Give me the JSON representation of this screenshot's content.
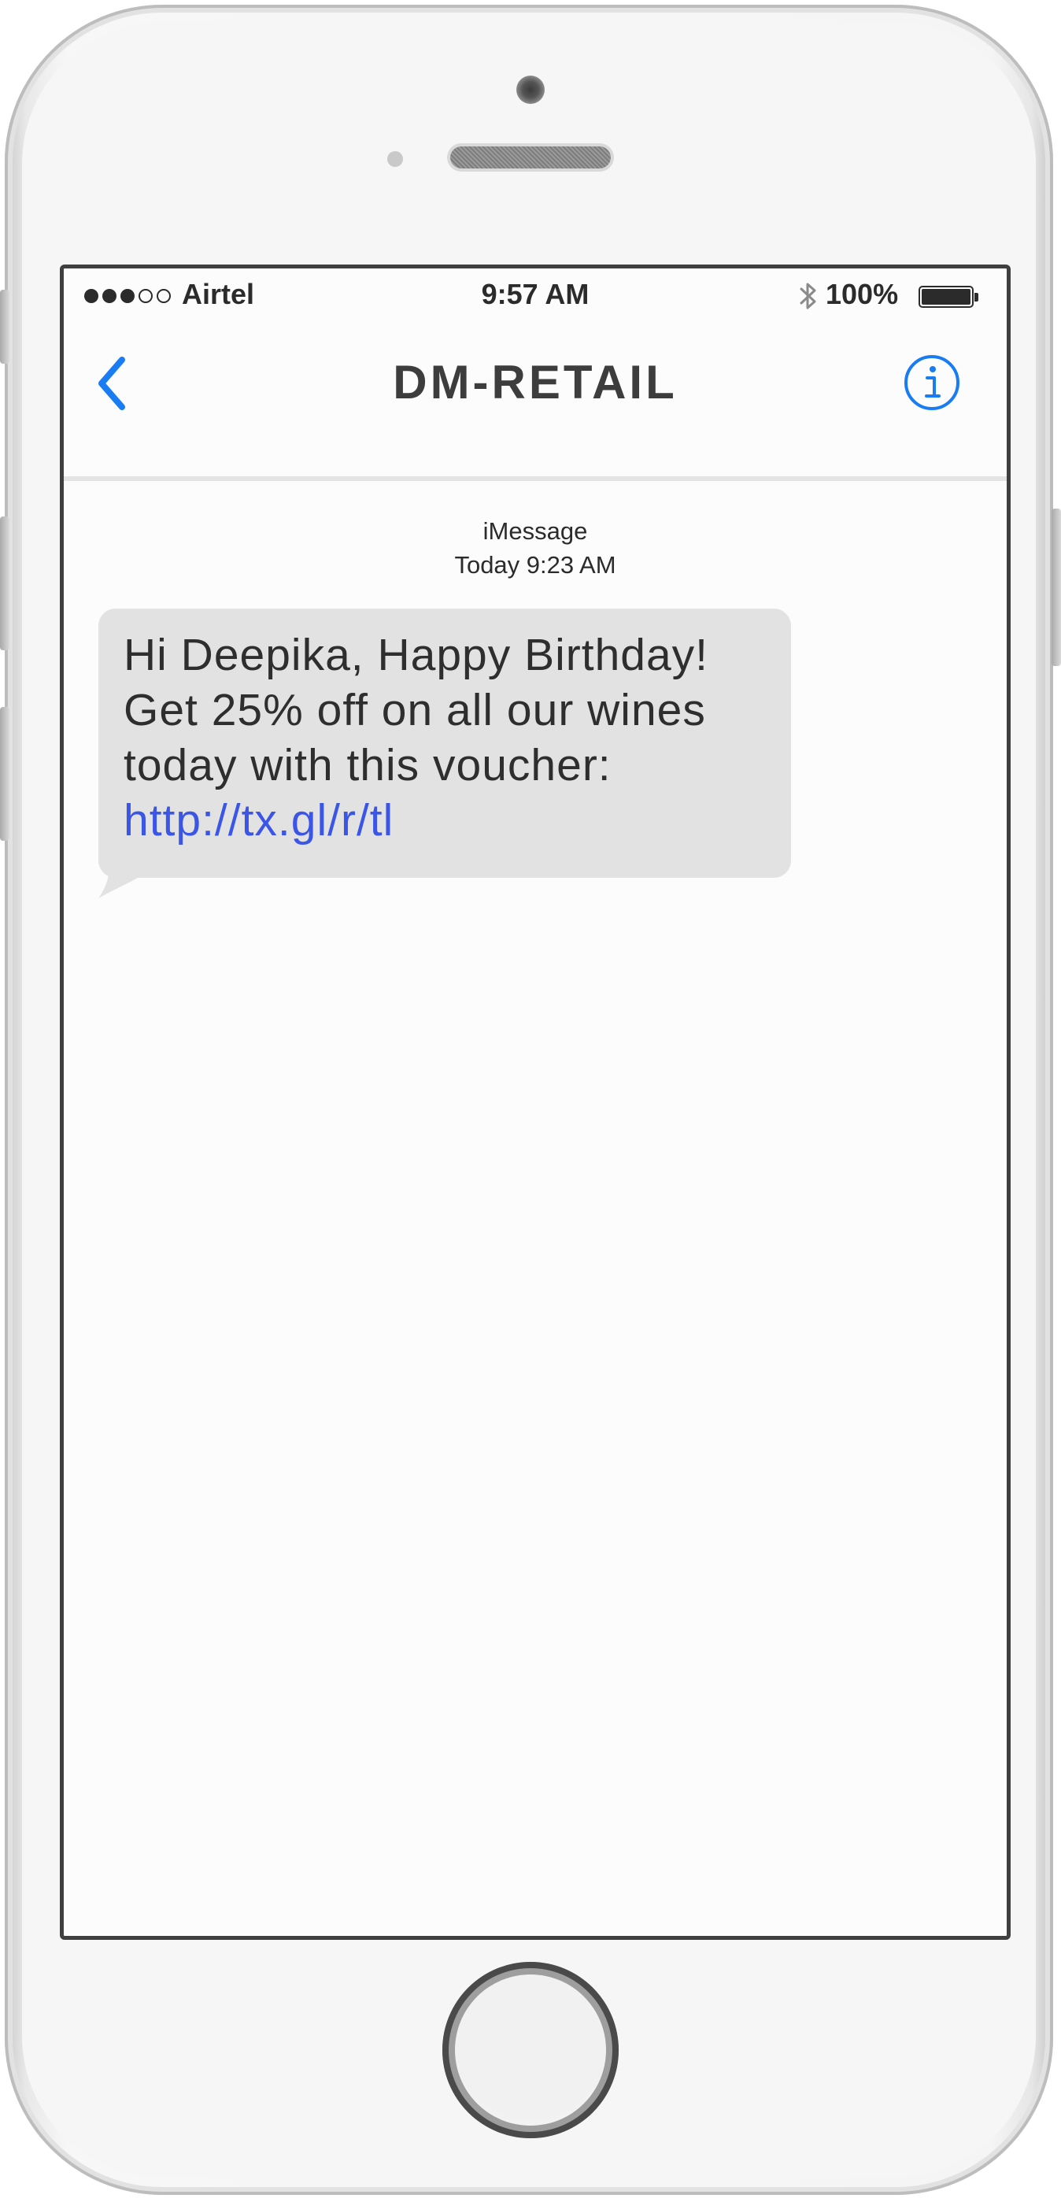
{
  "status_bar": {
    "signal": {
      "filled": 3,
      "total": 5
    },
    "carrier": "Airtel",
    "time": "9:57 AM",
    "battery_percent": "100%",
    "battery_level": 1.0,
    "icons": [
      "signal-dots-icon",
      "bluetooth-icon",
      "battery-icon"
    ]
  },
  "nav": {
    "title": "DM-RETAIL",
    "back_icon": "chevron-left-icon",
    "info_icon": "info-icon",
    "accent_color": "#1a7cf3"
  },
  "conversation": {
    "service": "iMessage",
    "timestamp": "Today 9:23 AM",
    "messages": [
      {
        "direction": "incoming",
        "lines": [
          "Hi Deepika, Happy Birthday!",
          "Get 25% off on all our wines",
          "today with this voucher:"
        ],
        "link": "http://tx.gl/r/tl"
      }
    ]
  },
  "colors": {
    "incoming_bubble": "#e2e2e2",
    "link": "#3b55e6",
    "screen_background": "#fcfcfc"
  }
}
